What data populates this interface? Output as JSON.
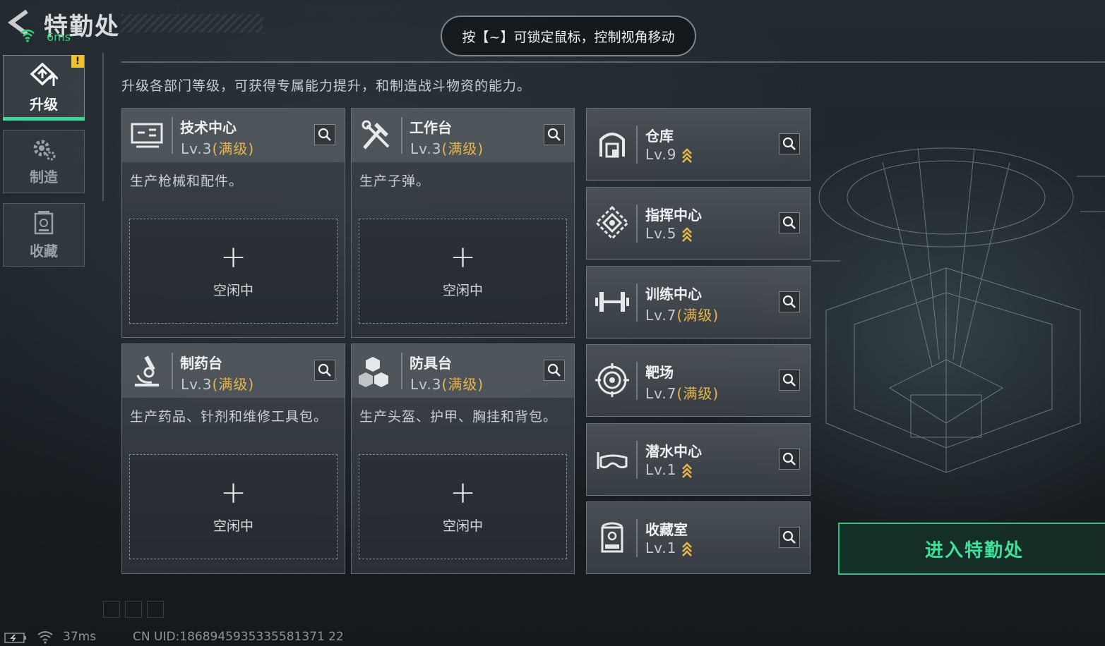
{
  "header": {
    "title": "特勤处",
    "ping": "6ms",
    "hint": "按【~】可锁定鼠标，控制视角移动",
    "description": "升级各部门等级，可获得专属能力提升，和制造战斗物资的能力。"
  },
  "nav": {
    "items": [
      {
        "label": "升级",
        "icon": "upgrade-icon",
        "active": true,
        "badge": "!"
      },
      {
        "label": "制造",
        "icon": "gear-icon",
        "active": false
      },
      {
        "label": "收藏",
        "icon": "collection-icon",
        "active": false
      }
    ]
  },
  "production_cards": [
    {
      "name": "技术中心",
      "level": "Lv.3",
      "max": "(满级)",
      "description": "生产枪械和配件。",
      "slot_plus": "+",
      "slot_status": "空闲中",
      "icon": "monitor-icon"
    },
    {
      "name": "工作台",
      "level": "Lv.3",
      "max": "(满级)",
      "description": "生产子弹。",
      "slot_plus": "+",
      "slot_status": "空闲中",
      "icon": "tools-icon"
    },
    {
      "name": "制药台",
      "level": "Lv.3",
      "max": "(满级)",
      "description": "生产药品、针剂和维修工具包。",
      "slot_plus": "+",
      "slot_status": "空闲中",
      "icon": "microscope-icon"
    },
    {
      "name": "防具台",
      "level": "Lv.3",
      "max": "(满级)",
      "description": "生产头盔、护甲、胸挂和背包。",
      "slot_plus": "+",
      "slot_status": "空闲中",
      "icon": "armor-boxes-icon"
    }
  ],
  "facilities": [
    {
      "name": "仓库",
      "level": "Lv.9",
      "max": "",
      "upgradable": true,
      "icon": "warehouse-icon"
    },
    {
      "name": "指挥中心",
      "level": "Lv.5",
      "max": "",
      "upgradable": true,
      "icon": "command-icon"
    },
    {
      "name": "训练中心",
      "level": "Lv.7",
      "max": "(满级)",
      "upgradable": false,
      "icon": "dumbbell-icon"
    },
    {
      "name": "靶场",
      "level": "Lv.7",
      "max": "(满级)",
      "upgradable": false,
      "icon": "target-icon"
    },
    {
      "name": "潜水中心",
      "level": "Lv.1",
      "max": "",
      "upgradable": true,
      "icon": "diving-mask-icon"
    },
    {
      "name": "收藏室",
      "level": "Lv.1",
      "max": "",
      "upgradable": true,
      "icon": "display-case-icon"
    }
  ],
  "enter_button": {
    "label": "进入特勤处"
  },
  "footer": {
    "ping": "37ms",
    "uid": "CN UID:1868945935335581371 22"
  },
  "colors": {
    "accent": "#3fe09c",
    "max_level": "#e8b64a",
    "warning": "#f0c22b"
  }
}
